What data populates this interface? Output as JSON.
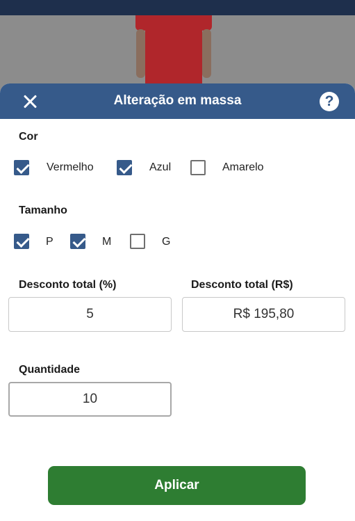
{
  "header": {
    "title": "Alteração em massa",
    "close_icon": "close-icon",
    "help_label": "?"
  },
  "cor": {
    "label": "Cor",
    "options": [
      {
        "label": "Vermelho",
        "checked": true
      },
      {
        "label": "Azul",
        "checked": true
      },
      {
        "label": "Amarelo",
        "checked": false
      }
    ]
  },
  "tamanho": {
    "label": "Tamanho",
    "options": [
      {
        "label": "P",
        "checked": true
      },
      {
        "label": "M",
        "checked": true
      },
      {
        "label": "G",
        "checked": false
      }
    ]
  },
  "desconto_pct": {
    "label": "Desconto total (%)",
    "value": "5"
  },
  "desconto_rs": {
    "label": "Desconto total (R$)",
    "value": "R$ 195,80"
  },
  "quantidade": {
    "label": "Quantidade",
    "value": "10"
  },
  "apply_button": "Aplicar",
  "colors": {
    "header": "#365a8a",
    "checkbox": "#365a8a",
    "apply": "#2e7d32",
    "topbar": "#1e2f4c"
  }
}
